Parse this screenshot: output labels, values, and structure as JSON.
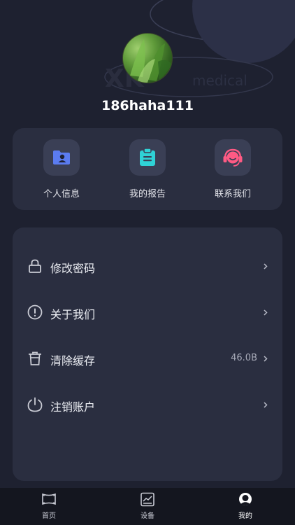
{
  "profile": {
    "username": "186haha111"
  },
  "quick_links": [
    {
      "label": "个人信息",
      "icon": "user-folder-icon"
    },
    {
      "label": "我的报告",
      "icon": "clipboard-icon"
    },
    {
      "label": "联系我们",
      "icon": "headset-icon"
    }
  ],
  "menu": [
    {
      "label": "修改密码",
      "icon": "lock-icon",
      "value": ""
    },
    {
      "label": "关于我们",
      "icon": "info-icon",
      "value": ""
    },
    {
      "label": "清除缓存",
      "icon": "trash-icon",
      "value": "46.0B"
    },
    {
      "label": "注销账户",
      "icon": "power-icon",
      "value": ""
    }
  ],
  "tabs": [
    {
      "label": "首页",
      "icon": "home-icon"
    },
    {
      "label": "设备",
      "icon": "device-chart-icon"
    },
    {
      "label": "我的",
      "icon": "profile-icon",
      "active": true
    }
  ],
  "brand": {
    "watermark": "medical"
  },
  "colors": {
    "bg": "#1e2130",
    "card": "#2a2e40",
    "icon_tile": "#3a3f55",
    "accent_blue": "#5b7cf0",
    "accent_cyan": "#2fd2d6",
    "accent_pink": "#ff5a84"
  }
}
